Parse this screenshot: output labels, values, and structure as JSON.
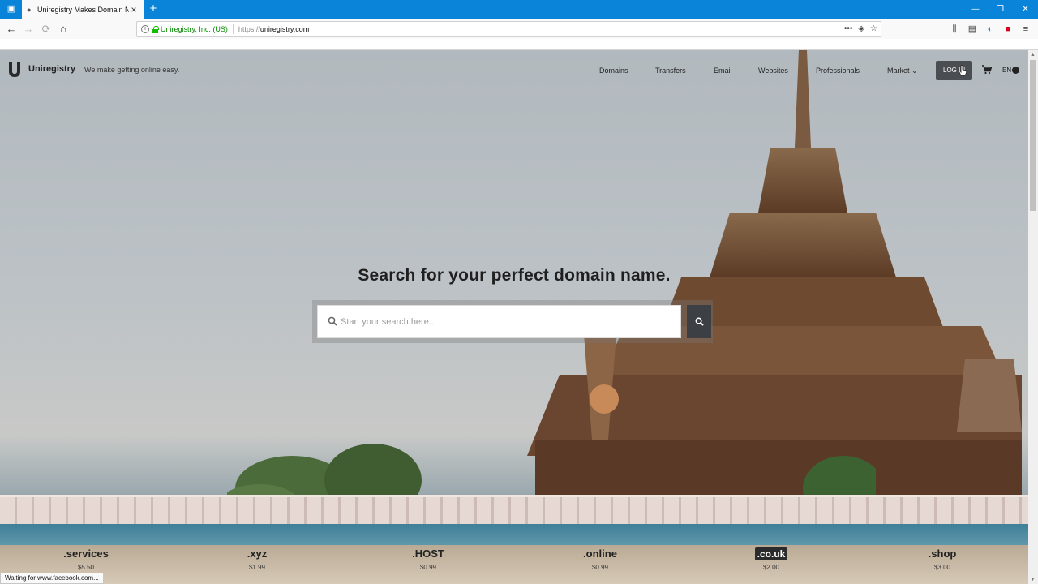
{
  "browser": {
    "tab_title": "Uniregistry Makes Domain Na",
    "identity": "Uniregistry, Inc. (US)",
    "url_protocol": "https://",
    "url_host": "uniregistry.com",
    "status_text": "Waiting for www.facebook.com..."
  },
  "site": {
    "logo_text": "Uniregistry",
    "tagline": "We make getting online easy.",
    "nav": [
      {
        "label": "Domains"
      },
      {
        "label": "Transfers"
      },
      {
        "label": "Email"
      },
      {
        "label": "Websites"
      },
      {
        "label": "Professionals"
      },
      {
        "label": "Market"
      }
    ],
    "login_label": "LOG IN",
    "lang": "EN"
  },
  "hero": {
    "title": "Search for your perfect domain name.",
    "search_placeholder": "Start your search here..."
  },
  "tlds": [
    {
      "name": ".services",
      "price": "$5.50"
    },
    {
      "name": ".xyz",
      "price": "$1.99"
    },
    {
      "name": ".HOST",
      "price": "$0.99"
    },
    {
      "name": ".online",
      "price": "$0.99"
    },
    {
      "name": ".co.uk",
      "price": "$2.00"
    },
    {
      "name": ".shop",
      "price": "$3.00"
    }
  ],
  "colors": {
    "chrome_blue": "#0a84d9",
    "secure_green": "#12bc00",
    "button_dark": "#3c3f44"
  }
}
